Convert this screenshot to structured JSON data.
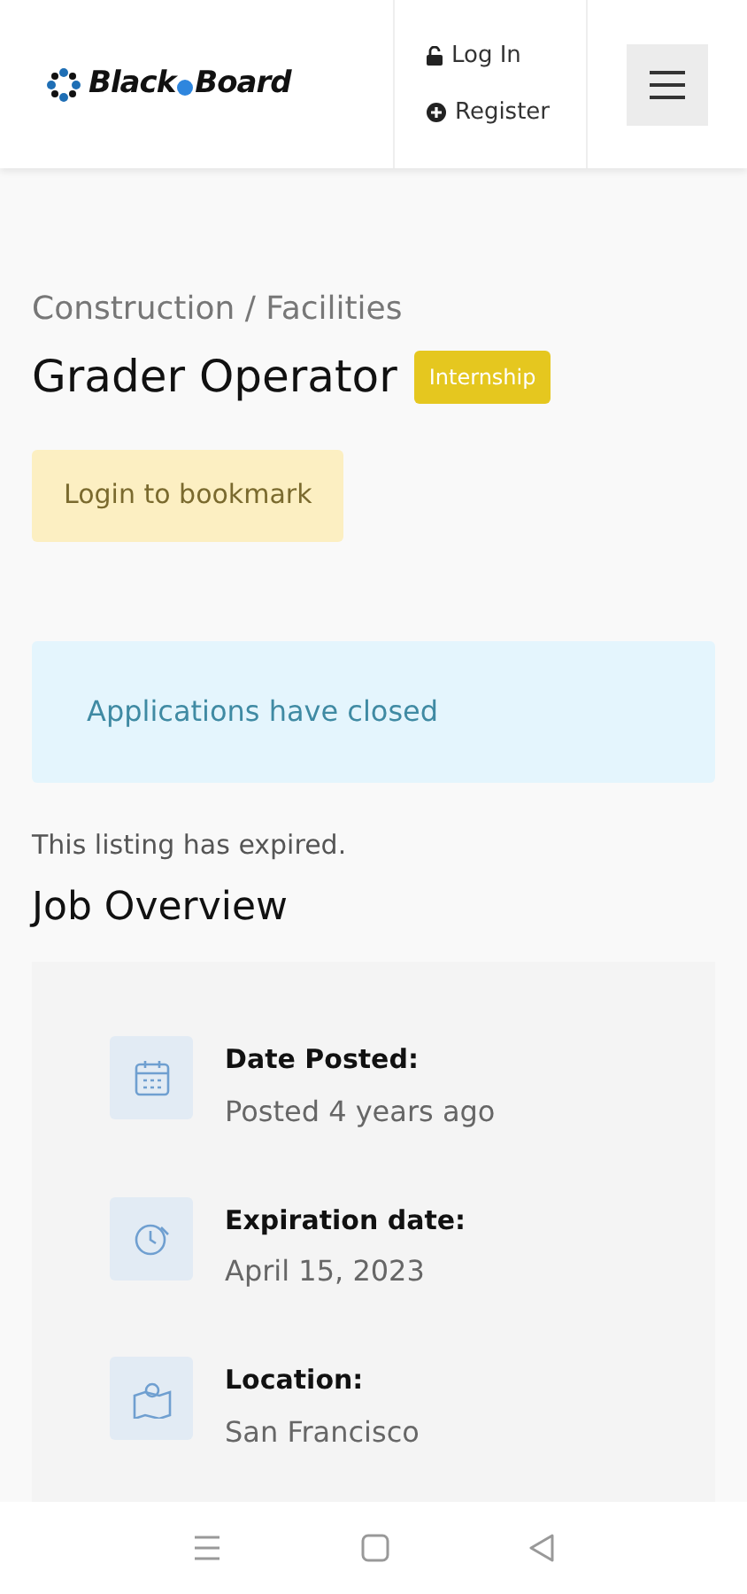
{
  "header": {
    "logo": [
      "Black",
      "Board"
    ],
    "links": [
      {
        "kind": "login",
        "label": "Log In"
      },
      {
        "kind": "register",
        "label": "Register"
      }
    ]
  },
  "job": {
    "category": "Construction / Facilities",
    "title": "Grader Operator",
    "badge": "Internship",
    "bookmark_button": "Login to bookmark",
    "alert": "Applications have closed",
    "expired_note": "This listing has expired."
  },
  "overview": {
    "heading": "Job Overview",
    "items": [
      {
        "kind": "calendar",
        "label": "Date Posted:",
        "value": "Posted 4 years ago"
      },
      {
        "kind": "clock",
        "label": "Expiration date:",
        "value": "April 15, 2023"
      },
      {
        "kind": "map",
        "label": "Location:",
        "value": "San Francisco"
      }
    ]
  }
}
